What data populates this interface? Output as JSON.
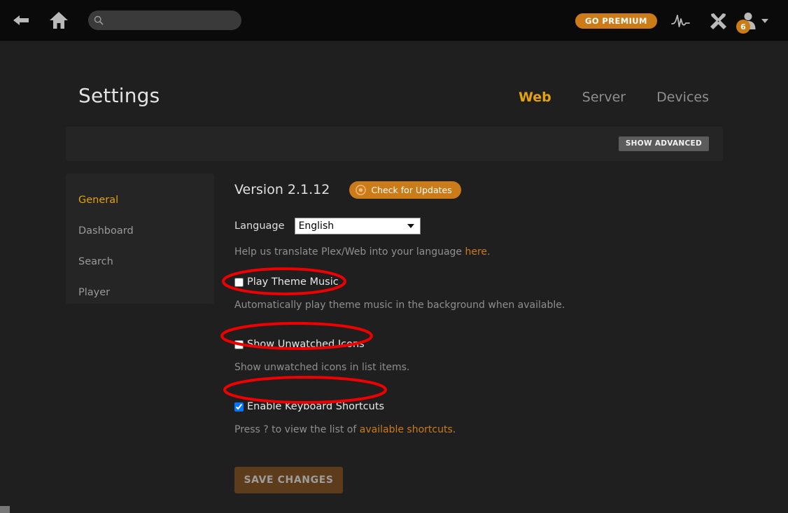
{
  "header": {
    "back_icon": "arrow-left-icon",
    "home_icon": "home-icon",
    "search": {
      "icon": "search-icon",
      "value": "",
      "placeholder": ""
    },
    "go_premium_label": "GO PREMIUM",
    "activity_icon": "activity-pulse-icon",
    "tools_icon": "wrench-tools-icon",
    "user": {
      "avatar_icon": "user-avatar-icon",
      "badge_count": "6",
      "caret_icon": "chevron-down-icon"
    }
  },
  "page": {
    "title": "Settings",
    "tabs": [
      {
        "label": "Web",
        "active": true
      },
      {
        "label": "Server",
        "active": false
      },
      {
        "label": "Devices",
        "active": false
      }
    ],
    "show_advanced_label": "SHOW ADVANCED"
  },
  "sidebar": {
    "items": [
      {
        "label": "General",
        "active": true
      },
      {
        "label": "Dashboard",
        "active": false
      },
      {
        "label": "Search",
        "active": false
      },
      {
        "label": "Player",
        "active": false
      }
    ]
  },
  "main": {
    "version_text": "Version 2.1.12",
    "check_updates": {
      "label": "Check for Updates",
      "icon": "refresh-circle-icon"
    },
    "language": {
      "label": "Language",
      "selected": "English",
      "options": [
        "English"
      ],
      "caret_icon": "chevron-down-icon"
    },
    "translate_help": {
      "text": "Help us translate Plex/Web into your language ",
      "link_text": "here",
      "suffix": "."
    },
    "options": [
      {
        "label": "Play Theme Music",
        "checked": false,
        "description": "Automatically play theme music in the background when available.",
        "annotated": true
      },
      {
        "label": "Show Unwatched Icons",
        "checked": false,
        "description": "Show unwatched icons in list items.",
        "annotated": true
      },
      {
        "label": "Enable Keyboard Shortcuts",
        "checked": true,
        "description_prefix": "Press ? to view the list of ",
        "description_link": "available shortcuts",
        "description_suffix": ".",
        "annotated": true
      }
    ],
    "save_label": "SAVE CHANGES"
  },
  "colors": {
    "accent_orange": "#cc7b19",
    "accent_gold": "#e5a00d",
    "annotation_red": "#ee0000",
    "page_bg": "#1f1f1f",
    "panel_bg": "#252525",
    "header_bg": "#0a0a0a"
  }
}
